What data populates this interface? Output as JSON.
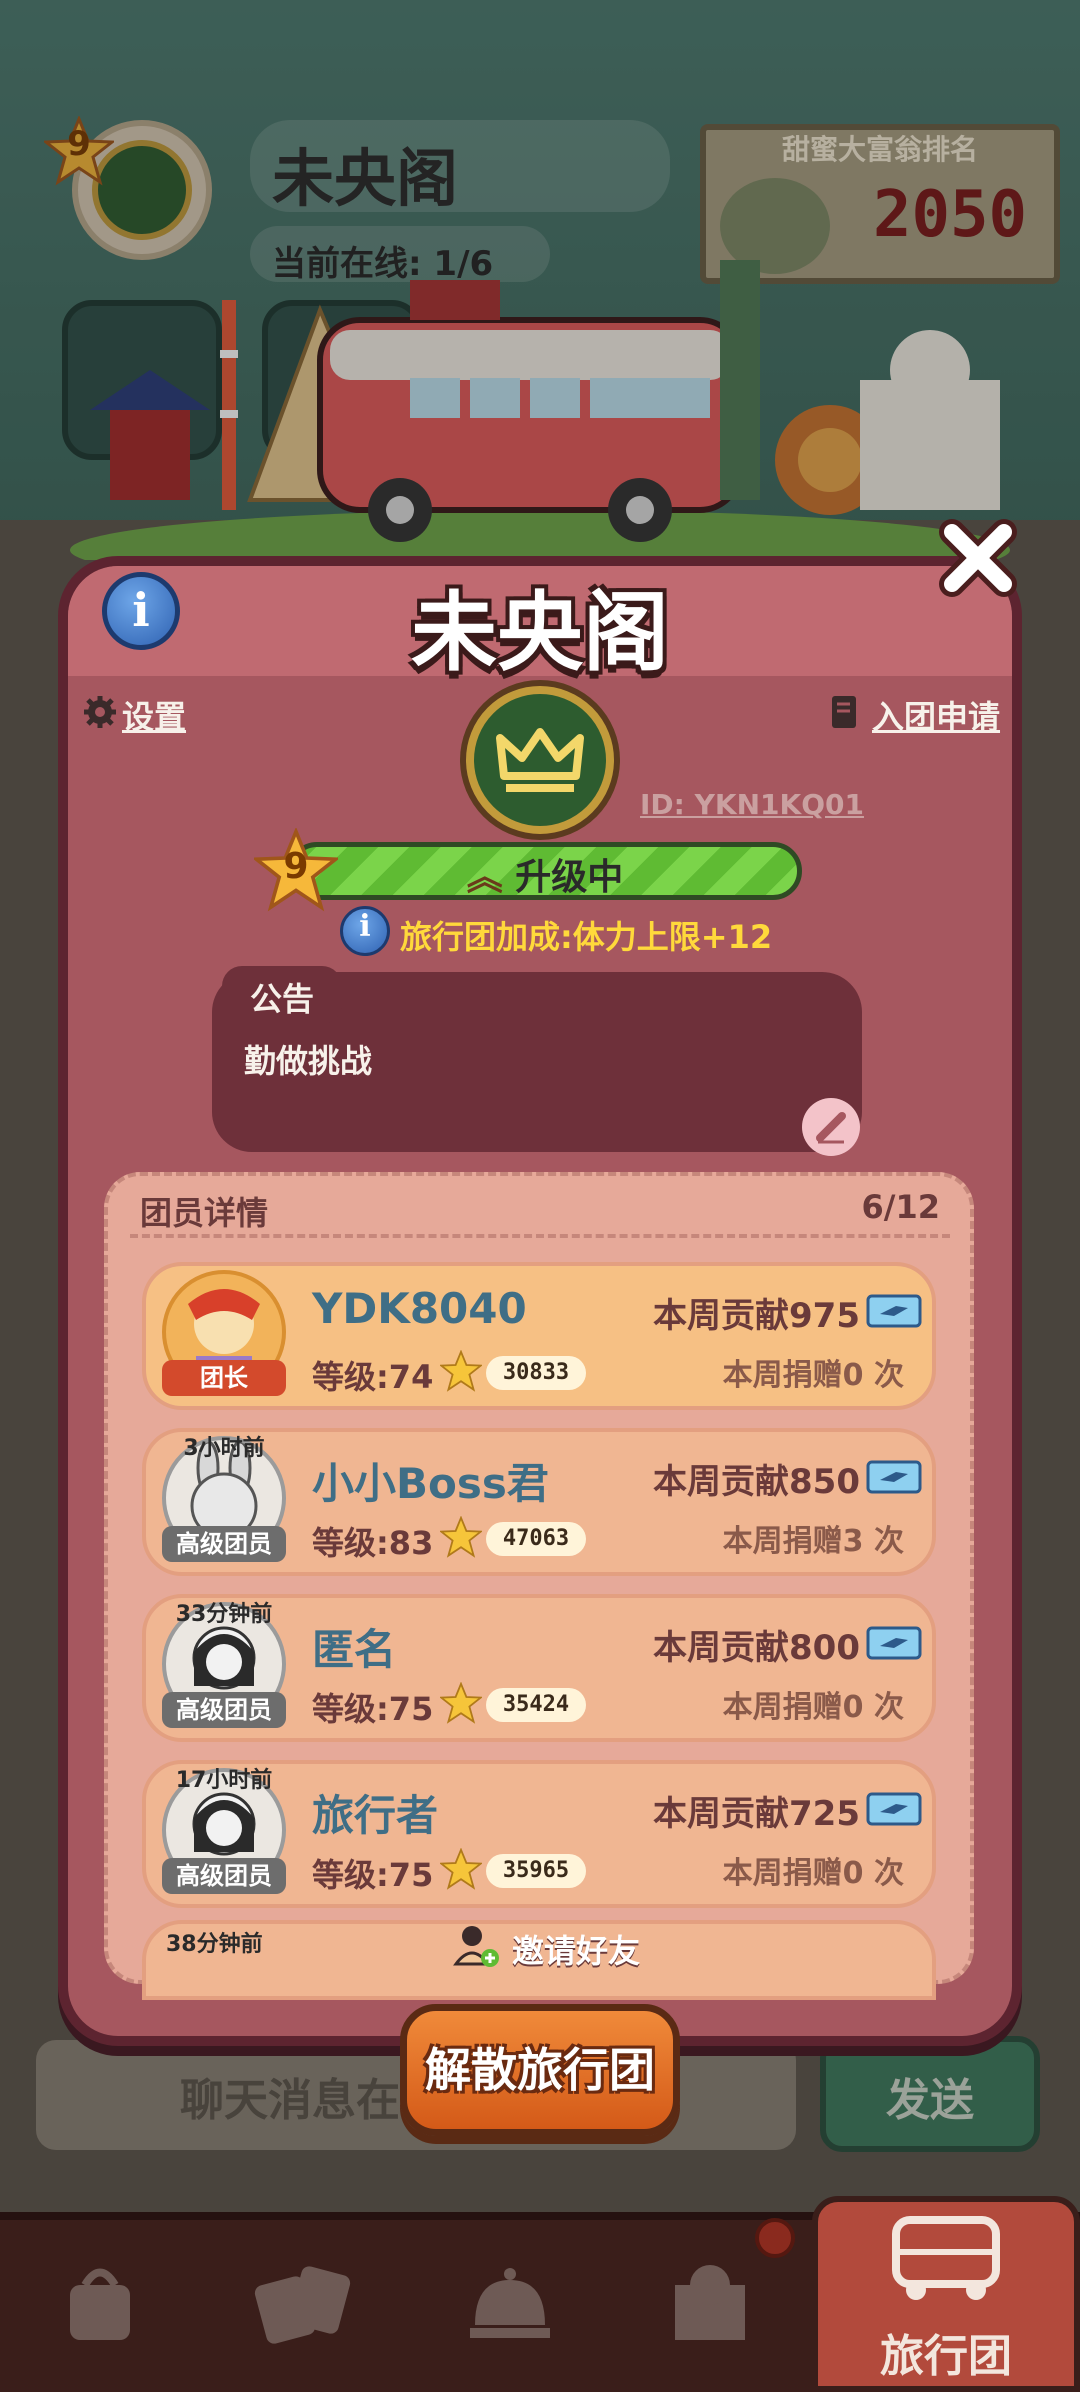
{
  "background": {
    "guild_level": "9",
    "guild_name": "未央阁",
    "online_status": "当前在线: 1/6",
    "rank_title": "甜蜜大富翁排名",
    "rank_value": "2050",
    "chat_placeholder": "聊天消息在",
    "send_label": "发送"
  },
  "modal": {
    "title": "未央阁",
    "settings_label": "设置",
    "apply_label": "入团申请",
    "guild_id": "ID: YKN1KQ01",
    "level": "9",
    "level_status": "升级中",
    "bonus_text": "旅行团加成:体力上限+12",
    "notice_label": "公告",
    "notice_text": "勤做挑战",
    "members_label": "团员详情",
    "members_count": "6/12",
    "members": [
      {
        "name": "YDK8040",
        "role": "团长",
        "time": "",
        "level": "等级:74",
        "score": "30833",
        "contribution": "本周贡献975",
        "donations": "本周捐赠0 次"
      },
      {
        "name": "小小Boss君",
        "role": "高级团员",
        "time": "3小时前",
        "level": "等级:83",
        "score": "47063",
        "contribution": "本周贡献850",
        "donations": "本周捐赠3 次"
      },
      {
        "name": "匿名",
        "role": "高级团员",
        "time": "33分钟前",
        "level": "等级:75",
        "score": "35424",
        "contribution": "本周贡献800",
        "donations": "本周捐赠0 次"
      },
      {
        "name": "旅行者",
        "role": "高级团员",
        "time": "17小时前",
        "level": "等级:75",
        "score": "35965",
        "contribution": "本周贡献725",
        "donations": "本周捐赠0 次"
      }
    ],
    "peek_time": "38分钟前",
    "invite_label": "邀请好友",
    "disband_label": "解散旅行团"
  },
  "navbar": {
    "items": [
      "shop",
      "cards",
      "service-bell",
      "map"
    ],
    "active_label": "旅行团"
  },
  "colors": {
    "modal_bg": "#a6575f",
    "header_bg": "#c06a71",
    "member_card": "#f0b692",
    "level_bar": "#7bd44a",
    "bonus_text": "#ffd93b",
    "disband_button": "#e56f25"
  }
}
